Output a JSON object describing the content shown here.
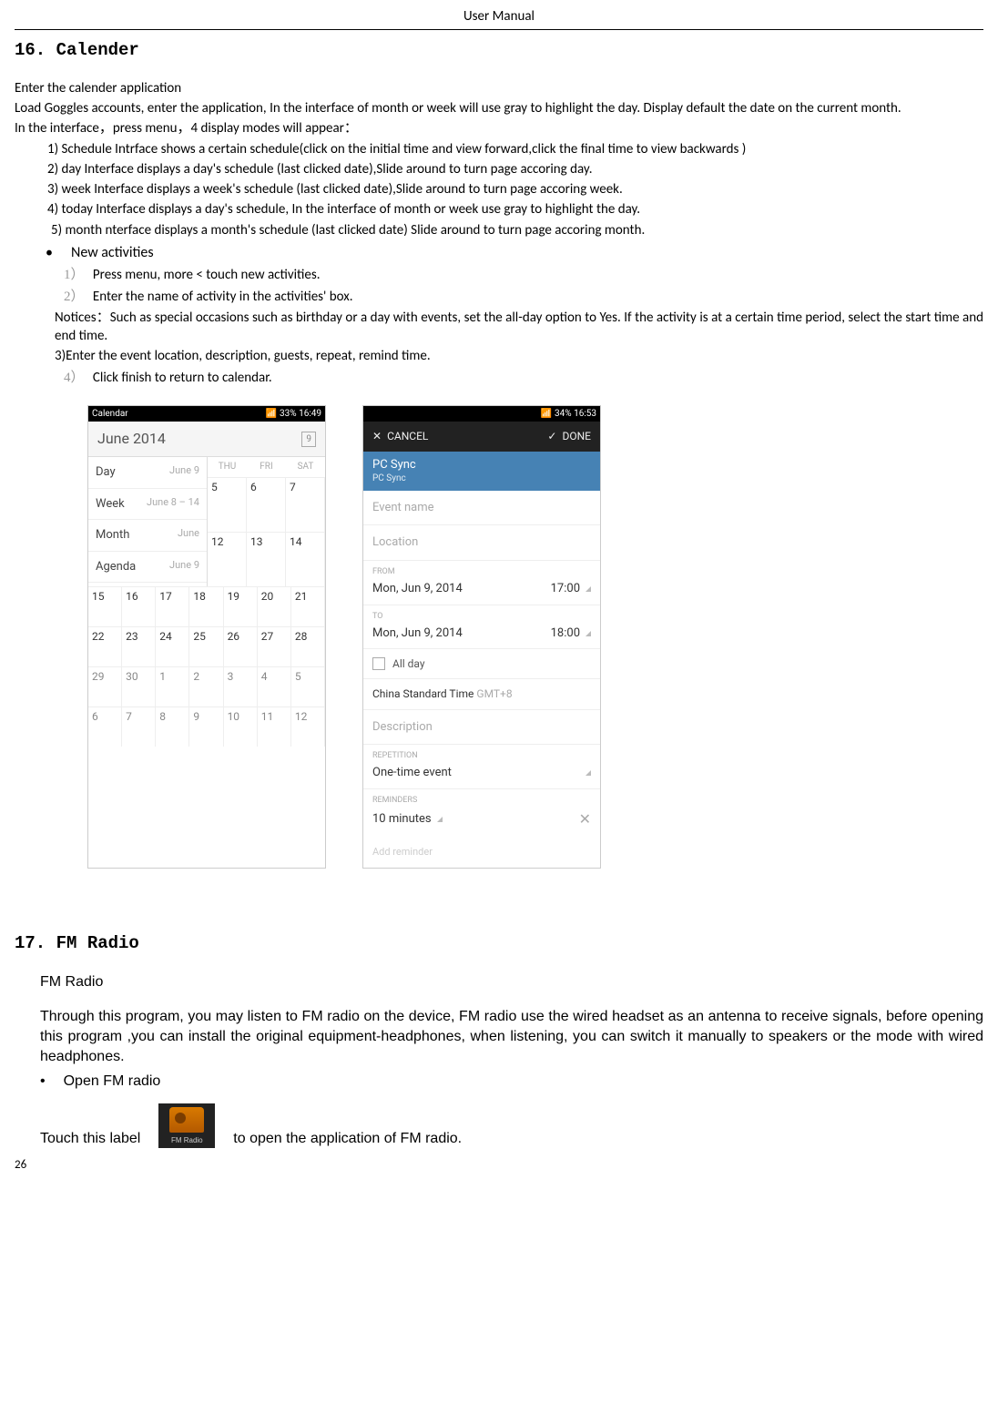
{
  "header": "User    Manual",
  "section16_title": "16.  Calender",
  "p_enter": "Enter the calender application",
  "p_load": "Load Goggles accounts, enter the application, In the interface of month or week will use gray to highlight the day. Display default the date on the current month.",
  "p_interface": "In the interface，press menu，4 display modes will appear：",
  "m1": "1) Schedule Intrface shows a certain schedule(click on the initial time and view forward,click the final time to view backwards )",
  "m2": "2) day       Interface displays a day's schedule (last clicked date),Slide around to turn page accoring day.",
  "m3": "3) week    Interface displays a   week's schedule (last clicked date),Slide around to turn page accoring week.",
  "m4": "4) today   Interface displays a day's schedule, In the interface of month or week use gray to highlight the day.",
  "m5": "5) month      nterface displays a   month's schedule (last clicked date) Slide around to turn page accoring month.",
  "bullet_new": "New activities",
  "n1_num": "1）",
  "n1": "Press menu, more < touch new activities.",
  "n2_num": "2）",
  "n2": "Enter the name of activity in the activities' box.",
  "notices": "Notices：Such as special occasions such as birthday or a day with events, set the all-day option to Yes. If the activity is at a certain time period, select the start time and end time.",
  "n3": "3)Enter the event location, description, guests, repeat, remind time.",
  "n4_num": "4）",
  "n4": "Click finish to return to calendar.",
  "shot1": {
    "status_left": "Calendar",
    "status_right": "33%  16:49",
    "month_title": "June 2014",
    "today_num": "9",
    "menu": [
      {
        "l": "Day",
        "r": "June 9"
      },
      {
        "l": "Week",
        "r": "June 8 – 14"
      },
      {
        "l": "Month",
        "r": "June"
      },
      {
        "l": "Agenda",
        "r": "June 9"
      }
    ],
    "wk_head": [
      "THU",
      "FRI",
      "SAT"
    ],
    "mini_grid": [
      "5",
      "6",
      "7",
      "12",
      "13",
      "14"
    ],
    "rows": [
      [
        "15",
        "16",
        "17",
        "18",
        "19",
        "20",
        "21"
      ],
      [
        "22",
        "23",
        "24",
        "25",
        "26",
        "27",
        "28"
      ],
      [
        "29",
        "30",
        "1",
        "2",
        "3",
        "4",
        "5"
      ],
      [
        "6",
        "7",
        "8",
        "9",
        "10",
        "11",
        "12"
      ]
    ]
  },
  "shot2": {
    "status_right": "34%  16:53",
    "cancel": "CANCEL",
    "done": "DONE",
    "sync_title": "PC Sync",
    "sync_sub": "PC Sync",
    "event_name": "Event name",
    "location": "Location",
    "from_lbl": "FROM",
    "from_date": "Mon, Jun 9, 2014",
    "from_time": "17:00",
    "to_lbl": "TO",
    "to_date": "Mon, Jun 9, 2014",
    "to_time": "18:00",
    "all_day": "All day",
    "tz": "China Standard Time",
    "tz_off": "GMT+8",
    "desc": "Description",
    "rep_lbl": "REPETITION",
    "rep_val": "One-time event",
    "rem_lbl": "REMINDERS",
    "rem_val": "10 minutes",
    "add_rem": "Add reminder"
  },
  "section17_title": "17. FM Radio",
  "fm_h": "FM Radio",
  "fm_body": "Through this program, you may listen to FM radio on the device, FM radio use the wired headset as an antenna to receive signals, before opening this program ,you can install  the original equipment-headphones, when listening, you can switch it manually  to speakers or the mode with wired headphones.",
  "fm_bullet": "Open FM radio",
  "fm_touch_pre": "Touch this label",
  "fm_icon_label": "FM Radio",
  "fm_touch_post": "to open the application of FM radio.",
  "page_num": "26"
}
